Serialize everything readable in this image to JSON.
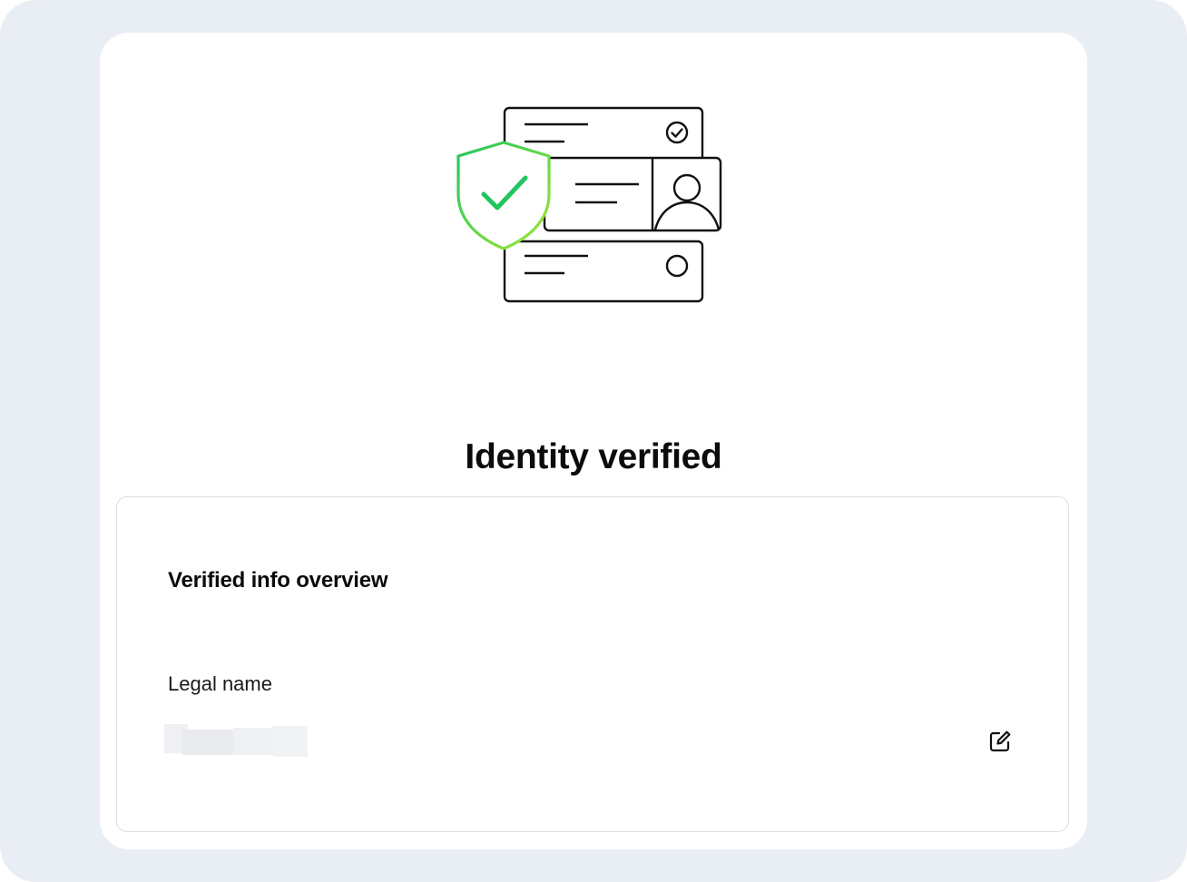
{
  "page": {
    "title": "Identity verified"
  },
  "overview": {
    "title": "Verified info overview",
    "fields": [
      {
        "label": "Legal name",
        "value_redacted": true
      }
    ]
  },
  "icons": {
    "hero": "identity-verified-illustration",
    "shield": "shield-check-icon",
    "edit": "edit-icon"
  },
  "colors": {
    "frame_background": "#e9edf4",
    "card_background": "#ffffff",
    "accent_green": "#22c55e",
    "accent_lime": "#a3e635",
    "title_text": "#0b0b0b"
  }
}
